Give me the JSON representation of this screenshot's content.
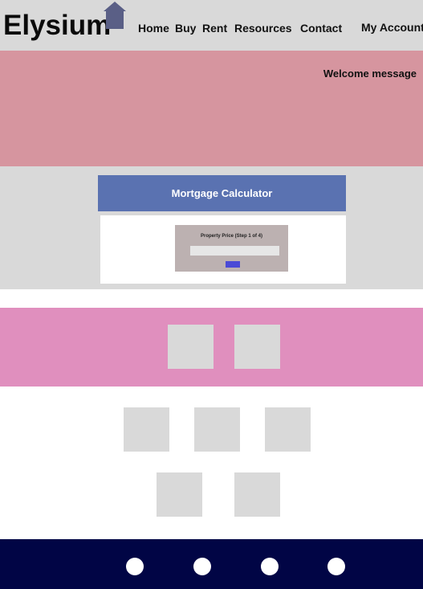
{
  "header": {
    "logo_text": "Elysium",
    "nav": [
      "Home",
      "Buy",
      "Rent",
      "Resources",
      "Contact"
    ],
    "account_label": "My Account"
  },
  "hero": {
    "welcome_text": "Welcome message",
    "background_color": "#d6959f"
  },
  "calculator": {
    "title": "Mortgage Calculator",
    "step_label": "Property Price (Step 1 of 4)",
    "input_value": "",
    "next_button_label": "",
    "header_color": "#5a72b1",
    "button_color": "#4a4ad6"
  },
  "featured": {
    "background_color": "#e08fbe",
    "tile_count": 2
  },
  "gallery": {
    "tile_count": 5
  },
  "footer": {
    "background_color": "#010545",
    "social_links": [
      "",
      "",
      "",
      ""
    ]
  },
  "icons": {
    "logo": "house-icon"
  }
}
